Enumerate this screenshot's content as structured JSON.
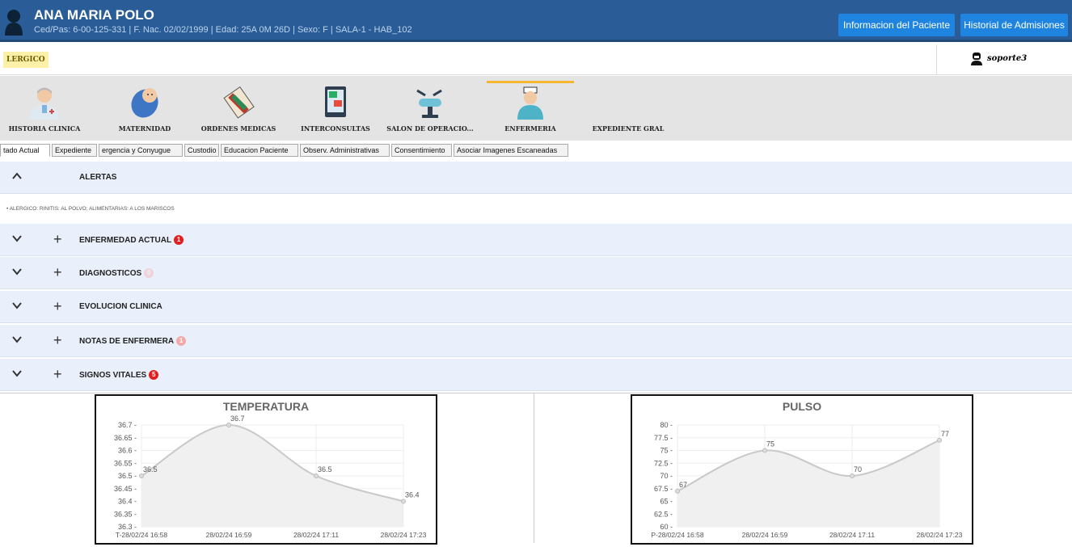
{
  "patient": {
    "name": "ANA MARIA POLO",
    "info": "Ced/Pas: 6-00-125-331 | F. Nac. 02/02/1999 | Edad: 25A 0M 26D | Sexo: F  | SALA-1  - HAB_102"
  },
  "header_buttons": {
    "patient_info": "Informacion del Paciente",
    "admissions": "Historial de Admisiones"
  },
  "allergy_badge": "LERGICO",
  "user": {
    "name": "soporte3",
    "icon": "user-icon"
  },
  "modules": [
    {
      "label": "HISTORIA CLINICA",
      "icon": "doctor-icon"
    },
    {
      "label": "MATERNIDAD",
      "icon": "baby-icon"
    },
    {
      "label": "ORDENES MEDICAS",
      "icon": "medical-orders-icon"
    },
    {
      "label": "INTERCONSULTAS",
      "icon": "interconsult-icon"
    },
    {
      "label": "SALON DE OPERACIO...",
      "icon": "operating-room-icon"
    },
    {
      "label": "ENFERMERIA",
      "icon": "nurse-icon",
      "active": true
    },
    {
      "label": "EXPEDIENTE GRAL",
      "icon": ""
    }
  ],
  "tabs": [
    "tado Actual",
    "Expediente",
    "ergencia y Conyugue",
    "Custodio",
    "Educacion Paciente",
    "Observ. Administrativas",
    "Consentimiento",
    "Asociar Imagenes Escaneadas"
  ],
  "panels": {
    "alerts": {
      "title": "ALERTAS"
    },
    "alert_text": "•  ALERGICO: RINITIS: AL POLVO; ALIMENTARIAS: A LOS MARISCOS",
    "enfermedad": {
      "title": "ENFERMEDAD ACTUAL",
      "count": "1"
    },
    "diagnosticos": {
      "title": "DIAGNOSTICOS",
      "count": "0"
    },
    "evolucion": {
      "title": "EVOLUCION CLINICA"
    },
    "notas": {
      "title": "NOTAS DE ENFERMERA",
      "count": "1"
    },
    "signos": {
      "title": "SIGNOS VITALES",
      "count": "5"
    }
  },
  "colors": {
    "header": "#2a5d97",
    "button": "#1f84e0",
    "panel": "#eaf0fb",
    "badge": "#e02020",
    "active_module": "#f5b731"
  },
  "chart_data": [
    {
      "type": "line",
      "title": "TEMPERATURA",
      "categories": [
        "T-28/02/24 16:58",
        "28/02/24 16:59",
        "28/02/24 17:11",
        "28/02/24 17:23"
      ],
      "values": [
        36.5,
        36.7,
        36.5,
        36.4
      ],
      "ylim": [
        36.3,
        36.7
      ],
      "yticks": [
        "36.7",
        "36.65",
        "36.6",
        "36.55",
        "36.5",
        "36.45",
        "36.4",
        "36.35",
        "36.3"
      ],
      "grid": true
    },
    {
      "type": "line",
      "title": "PULSO",
      "categories": [
        "P-28/02/24 16:58",
        "28/02/24 16:59",
        "28/02/24 17:11",
        "28/02/24 17:23"
      ],
      "values": [
        67,
        75,
        70,
        77
      ],
      "ylim": [
        60,
        80
      ],
      "yticks": [
        "80",
        "77.5",
        "75",
        "72.5",
        "70",
        "67.5",
        "65",
        "62.5",
        "60"
      ],
      "grid": true
    }
  ]
}
